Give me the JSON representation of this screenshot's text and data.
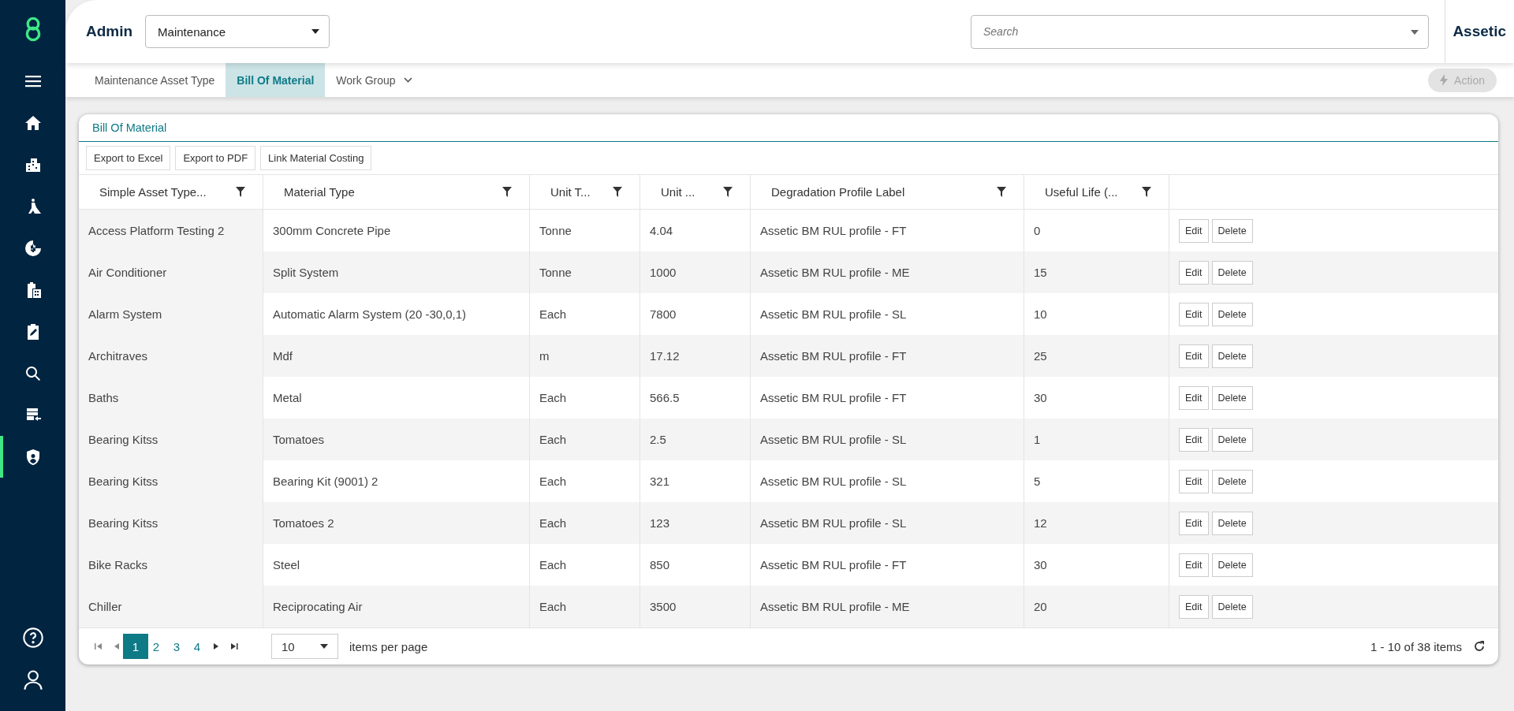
{
  "sidebar": {
    "items": [
      {
        "selected": false
      },
      {
        "selected": false
      },
      {
        "selected": false
      },
      {
        "selected": false
      },
      {
        "selected": false
      },
      {
        "selected": false
      },
      {
        "selected": false
      },
      {
        "selected": false
      },
      {
        "selected": false
      },
      {
        "selected": true
      }
    ]
  },
  "header": {
    "title": "Admin",
    "module": "Maintenance",
    "search": {
      "placeholder": "Search"
    },
    "brand": "Assetic"
  },
  "tabs": [
    {
      "label": "Maintenance Asset Type",
      "selected": false,
      "dropdown": false
    },
    {
      "label": "Bill Of Material",
      "selected": true,
      "dropdown": false
    },
    {
      "label": "Work Group",
      "selected": false,
      "dropdown": true
    }
  ],
  "action": {
    "label": "Action",
    "disabled": true
  },
  "panel": {
    "title": "Bill Of Material",
    "toolbar": [
      "Export to Excel",
      "Export to PDF",
      "Link Material Costing"
    ]
  },
  "table": {
    "columns": [
      "Simple Asset Type...",
      "Material Type",
      "Unit T...",
      "Unit ...",
      "Degradation Profile Label",
      "Useful Life (..."
    ],
    "rows": [
      {
        "cells": [
          "Access Platform Testing 2",
          "300mm Concrete Pipe",
          "Tonne",
          "4.04",
          "Assetic BM RUL profile - FT",
          "0"
        ],
        "actions": [
          "Edit",
          "Delete"
        ]
      },
      {
        "cells": [
          "Air Conditioner",
          "Split System",
          "Tonne",
          "1000",
          "Assetic BM RUL profile - ME",
          "15"
        ],
        "actions": [
          "Edit",
          "Delete"
        ]
      },
      {
        "cells": [
          "Alarm System",
          "Automatic Alarm System (20 -30,0,1)",
          "Each",
          "7800",
          "Assetic BM RUL profile - SL",
          "10"
        ],
        "actions": [
          "Edit",
          "Delete"
        ]
      },
      {
        "cells": [
          "Architraves",
          "Mdf",
          "m",
          "17.12",
          "Assetic BM RUL profile - FT",
          "25"
        ],
        "actions": [
          "Edit",
          "Delete"
        ]
      },
      {
        "cells": [
          "Baths",
          "Metal",
          "Each",
          "566.5",
          "Assetic BM RUL profile - FT",
          "30"
        ],
        "actions": [
          "Edit",
          "Delete"
        ]
      },
      {
        "cells": [
          "Bearing Kitss",
          "Tomatoes",
          "Each",
          "2.5",
          "Assetic BM RUL profile - SL",
          "1"
        ],
        "actions": [
          "Edit",
          "Delete"
        ]
      },
      {
        "cells": [
          "Bearing Kitss",
          "Bearing Kit (9001) 2",
          "Each",
          "321",
          "Assetic BM RUL profile - SL",
          "5"
        ],
        "actions": [
          "Edit",
          "Delete"
        ]
      },
      {
        "cells": [
          "Bearing Kitss",
          "Tomatoes 2",
          "Each",
          "123",
          "Assetic BM RUL profile - SL",
          "12"
        ],
        "actions": [
          "Edit",
          "Delete"
        ]
      },
      {
        "cells": [
          "Bike Racks",
          "Steel",
          "Each",
          "850",
          "Assetic BM RUL profile - FT",
          "30"
        ],
        "actions": [
          "Edit",
          "Delete"
        ]
      },
      {
        "cells": [
          "Chiller",
          "Reciprocating Air",
          "Each",
          "3500",
          "Assetic BM RUL profile - ME",
          "20"
        ],
        "actions": [
          "Edit",
          "Delete"
        ]
      }
    ]
  },
  "pager": {
    "pages": [
      {
        "label": "1",
        "selected": true
      },
      {
        "label": "2",
        "selected": false
      },
      {
        "label": "3",
        "selected": false
      },
      {
        "label": "4",
        "selected": false
      }
    ],
    "page_size": "10",
    "page_size_label": "items per page",
    "summary": "1 - 10 of 38 items"
  }
}
